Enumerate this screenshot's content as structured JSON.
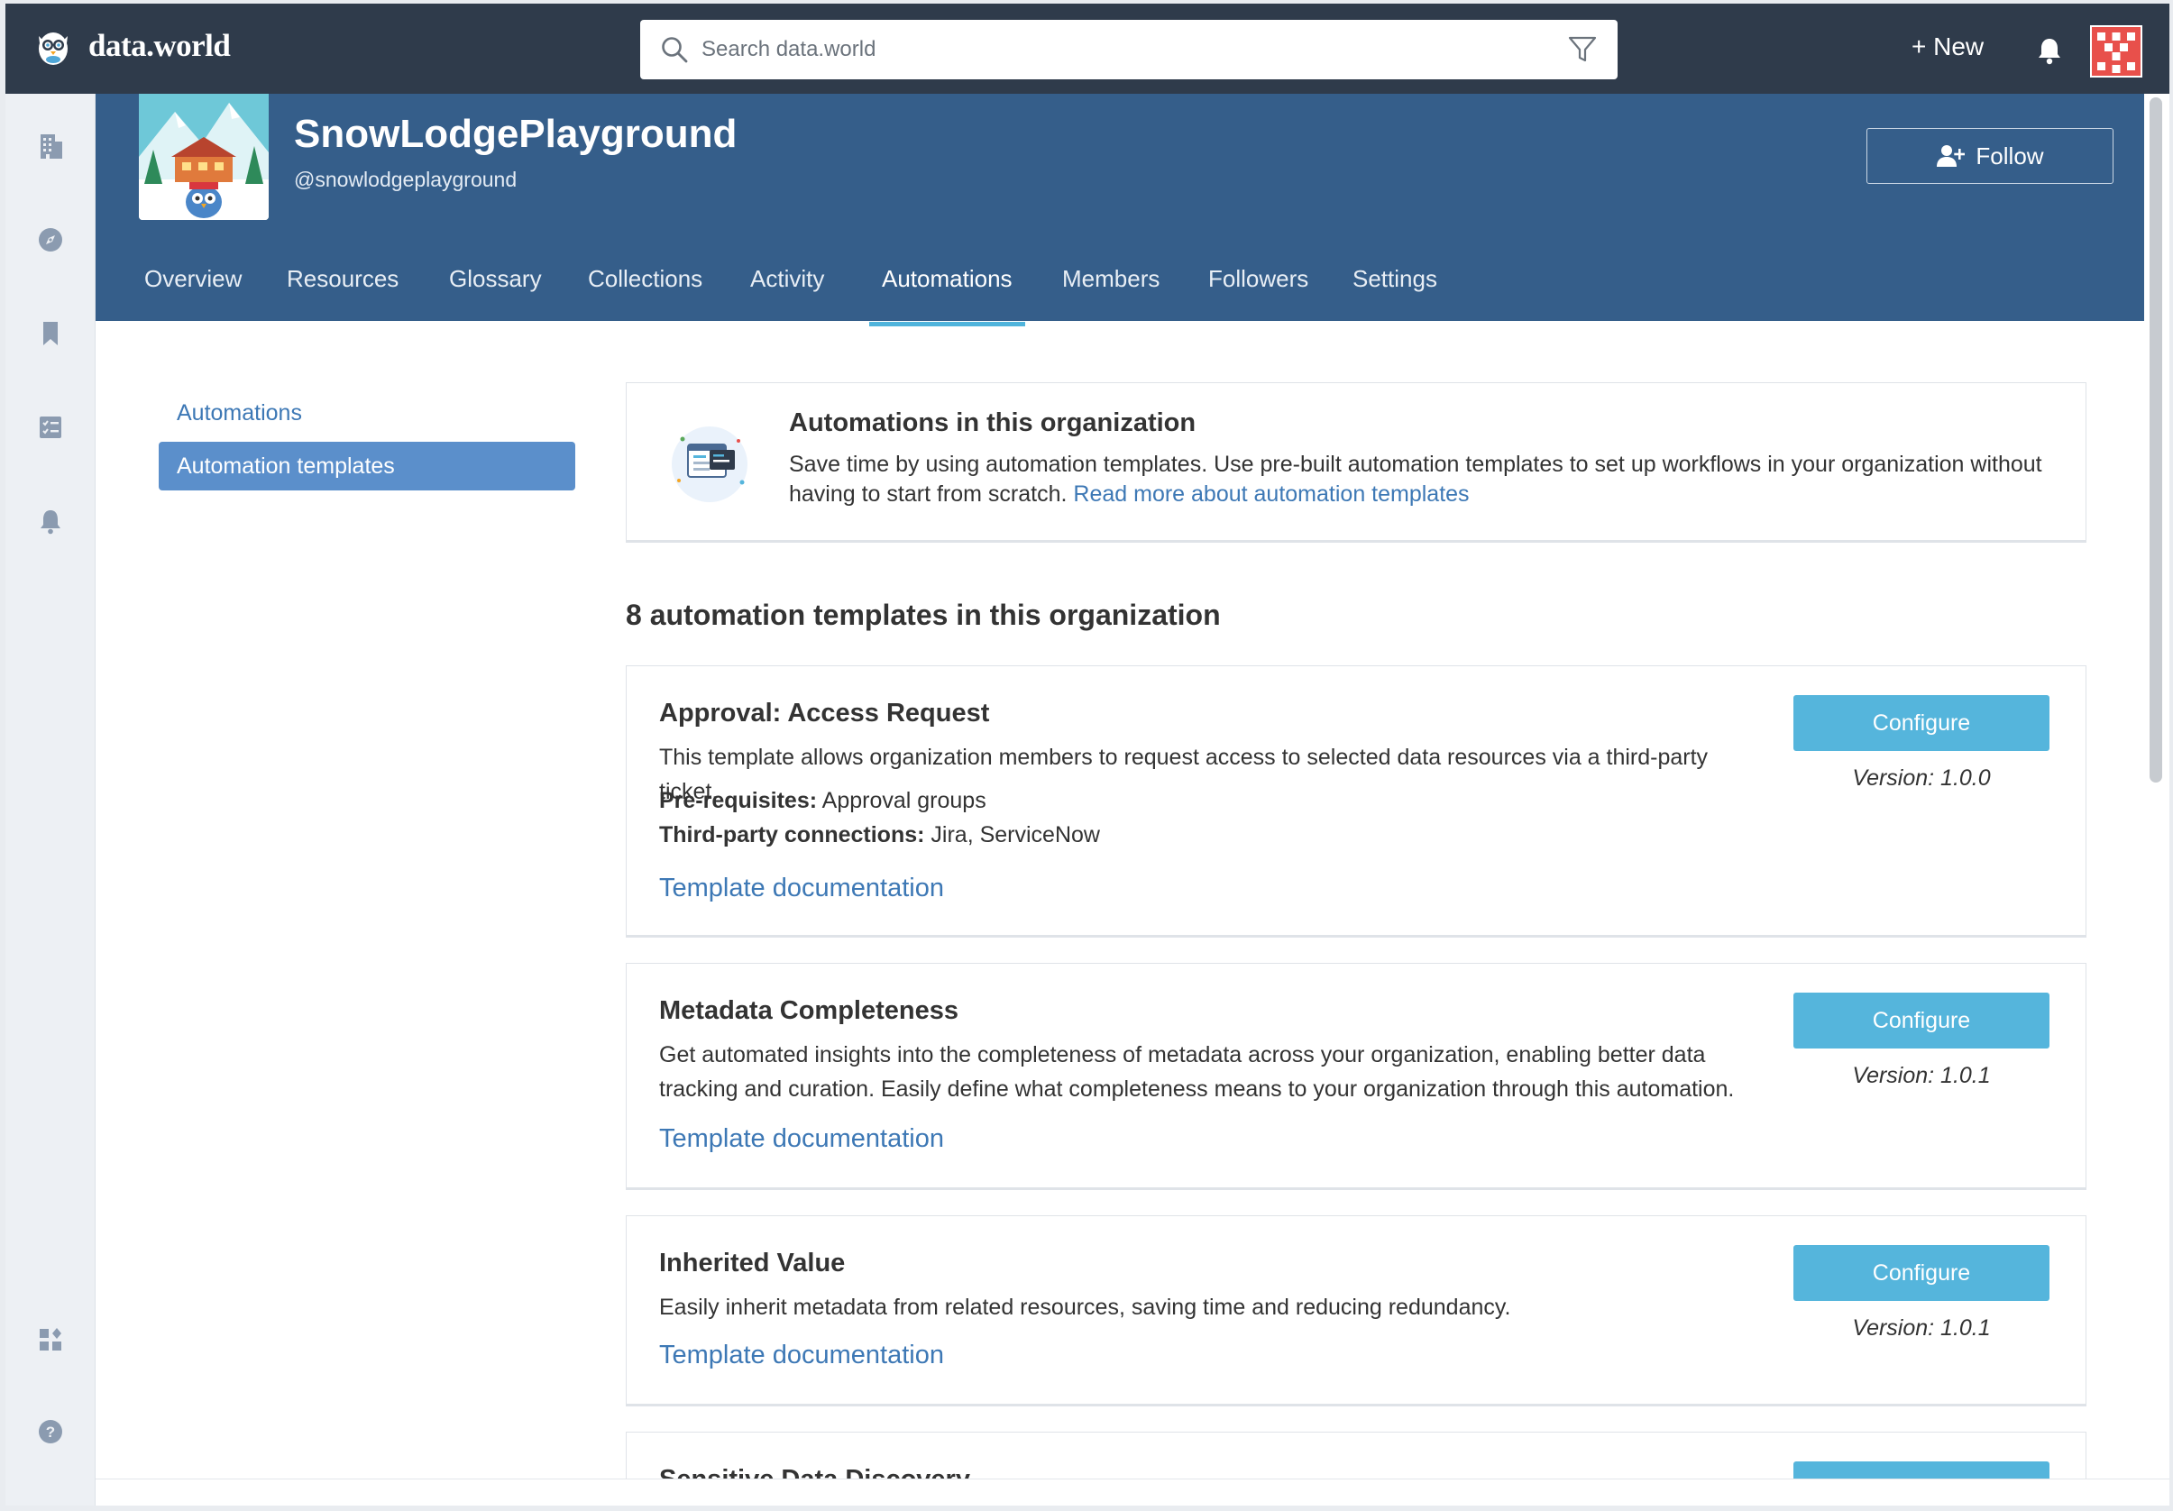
{
  "app": {
    "logo_text": "data.world",
    "search_placeholder": "Search data.world",
    "new_label": "+ New"
  },
  "org": {
    "name": "SnowLodgePlayground",
    "handle": "@snowlodgeplayground",
    "follow_label": "Follow"
  },
  "tabs": [
    {
      "label": "Overview"
    },
    {
      "label": "Resources"
    },
    {
      "label": "Glossary"
    },
    {
      "label": "Collections"
    },
    {
      "label": "Activity"
    },
    {
      "label": "Automations",
      "active": true
    },
    {
      "label": "Members"
    },
    {
      "label": "Followers"
    },
    {
      "label": "Settings"
    }
  ],
  "side_nav": {
    "automations": "Automations",
    "templates": "Automation templates"
  },
  "info": {
    "title": "Automations in this organization",
    "text": "Save time by using automation templates. Use pre-built automation templates to set up workflows in your organization without having to start from scratch.",
    "link": "Read more about automation templates"
  },
  "count_heading": "8 automation templates in this organization",
  "cards": [
    {
      "title": "Approval: Access Request",
      "description": "This template allows organization members to request access to selected data resources via a third-party ticket.",
      "prereq_label": "Pre-requisites:",
      "prereq_value": "Approval groups",
      "connections_label": "Third-party connections:",
      "connections_value": "Jira, ServiceNow",
      "doc_link": "Template documentation",
      "configure_label": "Configure",
      "version": "Version: 1.0.0"
    },
    {
      "title": "Metadata Completeness",
      "description": "Get automated insights into the completeness of metadata across your organization, enabling better data tracking and curation. Easily define what completeness means to your organization through this automation.",
      "doc_link": "Template documentation",
      "configure_label": "Configure",
      "version": "Version: 1.0.1"
    },
    {
      "title": "Inherited Value",
      "description": "Easily inherit metadata from related resources, saving time and reducing redundancy.",
      "doc_link": "Template documentation",
      "configure_label": "Configure",
      "version": "Version: 1.0.1"
    },
    {
      "title": "Sensitive Data Discovery"
    }
  ],
  "colors": {
    "topbar": "#2f3b4b",
    "org_header": "#355e8a",
    "accent": "#55b5dc",
    "link": "#3d78b5",
    "side_active": "#5b8fcb"
  },
  "icons": {
    "rail": [
      "building-icon",
      "compass-icon",
      "bookmark-icon",
      "tasks-icon",
      "bell-icon",
      "apps-icon",
      "help-icon"
    ]
  }
}
